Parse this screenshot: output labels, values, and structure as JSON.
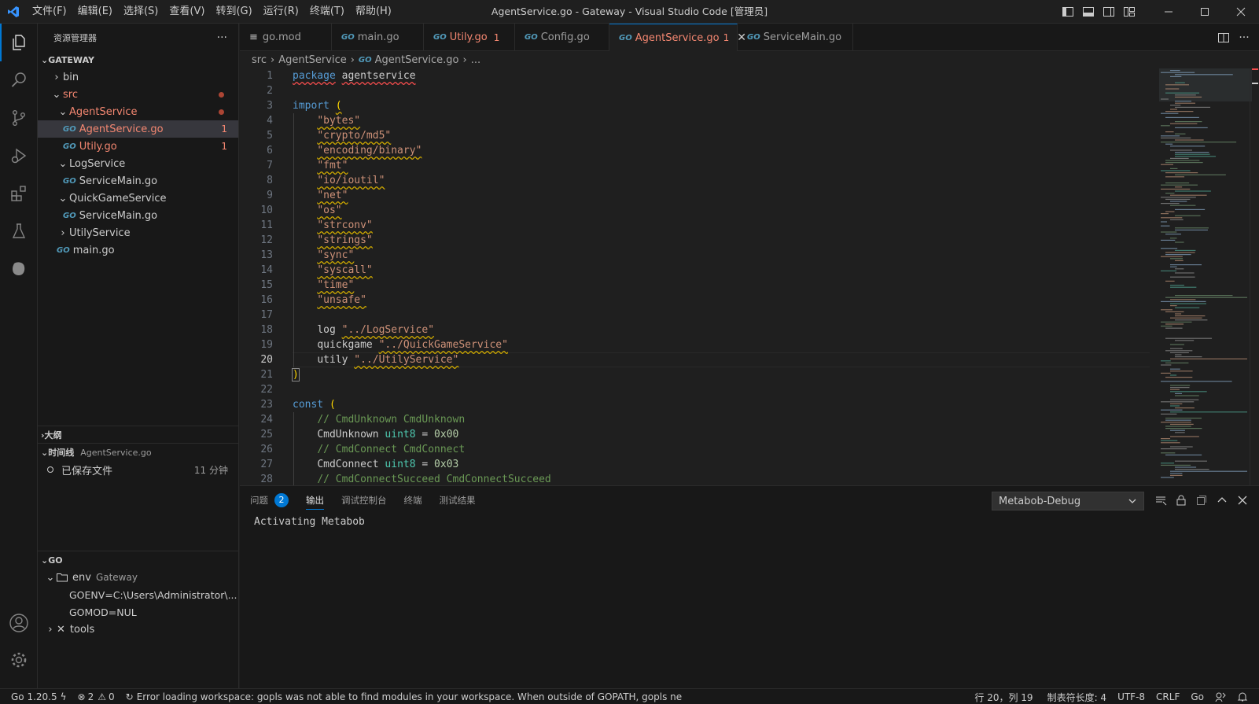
{
  "window": {
    "title": "AgentService.go - Gateway - Visual Studio Code [管理员]",
    "menu": [
      "文件(F)",
      "编辑(E)",
      "选择(S)",
      "查看(V)",
      "转到(G)",
      "运行(R)",
      "终端(T)",
      "帮助(H)"
    ]
  },
  "colors": {
    "accent": "#0078d4",
    "modified": "#f48771",
    "go_icon": "#519aba",
    "error": "#f14c4c"
  },
  "sidebar": {
    "header": "资源管理器",
    "more": "···",
    "workspace": "GATEWAY",
    "tree": {
      "bin": "bin",
      "src": "src",
      "agentservice_folder": "AgentService",
      "agentservice_go": "AgentService.go",
      "agentservice_go_count": "1",
      "utily_go": "Utily.go",
      "utily_go_count": "1",
      "logservice": "LogService",
      "logservice_main": "ServiceMain.go",
      "quickgameservice": "QuickGameService",
      "quickgame_main": "ServiceMain.go",
      "utilyservice": "UtilyService",
      "main_go": "main.go"
    },
    "outline": "大纲",
    "timeline": {
      "label": "时间线",
      "file": "AgentService.go",
      "entry": "已保存文件",
      "time": "11 分钟"
    },
    "go": {
      "label": "GO",
      "env": "env",
      "env_name": "Gateway",
      "goenv": "GOENV=C:\\Users\\Administrator\\...",
      "gomod": "GOMOD=NUL",
      "tools": "tools"
    }
  },
  "tabs": [
    {
      "label": "go.mod"
    },
    {
      "label": "main.go"
    },
    {
      "label": "Utily.go",
      "count": "1"
    },
    {
      "label": "Config.go"
    },
    {
      "label": "AgentService.go",
      "count": "1",
      "close": "✕"
    },
    {
      "label": "ServiceMain.go"
    }
  ],
  "breadcrumb": {
    "folder": "src",
    "sub": "AgentService",
    "file": "AgentService.go",
    "more": "..."
  },
  "editor": {
    "current_line": 20,
    "line_numbers": [
      "1",
      "2",
      "3",
      "4",
      "5",
      "6",
      "7",
      "8",
      "9",
      "10",
      "11",
      "12",
      "13",
      "14",
      "15",
      "16",
      "17",
      "18",
      "19",
      "20",
      "21",
      "22",
      "23",
      "24",
      "25",
      "26",
      "27",
      "28"
    ],
    "tokens": {
      "package": "package",
      "pkgname": "agentservice",
      "import": "import",
      "const": "const",
      "i_bytes": "\"bytes\"",
      "i_md5": "\"crypto/md5\"",
      "i_binary": "\"encoding/binary\"",
      "i_fmt": "\"fmt\"",
      "i_ioutil": "\"io/ioutil\"",
      "i_net": "\"net\"",
      "i_os": "\"os\"",
      "i_strconv": "\"strconv\"",
      "i_strings": "\"strings\"",
      "i_sync": "\"sync\"",
      "i_syscall": "\"syscall\"",
      "i_time": "\"time\"",
      "i_unsafe": "\"unsafe\"",
      "log": "log",
      "log_path": "\"../LogService\"",
      "quickgame": "quickgame",
      "quickgame_path": "\"../QuickGameService\"",
      "utily": "utily",
      "utily_path": "\"../UtilyService\"",
      "c24": "// CmdUnknown CmdUnknown",
      "n25": "CmdUnknown",
      "v25": "0x00",
      "c26": "// CmdConnect CmdConnect",
      "n27": "CmdConnect",
      "v27": "0x03",
      "c28": "// CmdConnectSucceed CmdConnectSucceed",
      "uint8": "uint8",
      "eq": "=",
      "lparen": "(",
      "rparen": ")"
    }
  },
  "panel": {
    "tabs": {
      "problems": "问题",
      "problems_count": "2",
      "output": "输出",
      "debug": "调试控制台",
      "terminal": "终端",
      "tests": "测试结果"
    },
    "channel": "Metabob-Debug",
    "output": "Activating Metabob"
  },
  "statusbar": {
    "go_version": "Go 1.20.5",
    "errors": "2",
    "warnings": "0",
    "message": "Error loading workspace: gopls was not able to find modules in your workspace. When outside of GOPATH, gopls ne",
    "position": "行 20，列 19",
    "tabsize": "制表符长度: 4",
    "encoding": "UTF-8",
    "eol": "CRLF",
    "language": "Go"
  }
}
